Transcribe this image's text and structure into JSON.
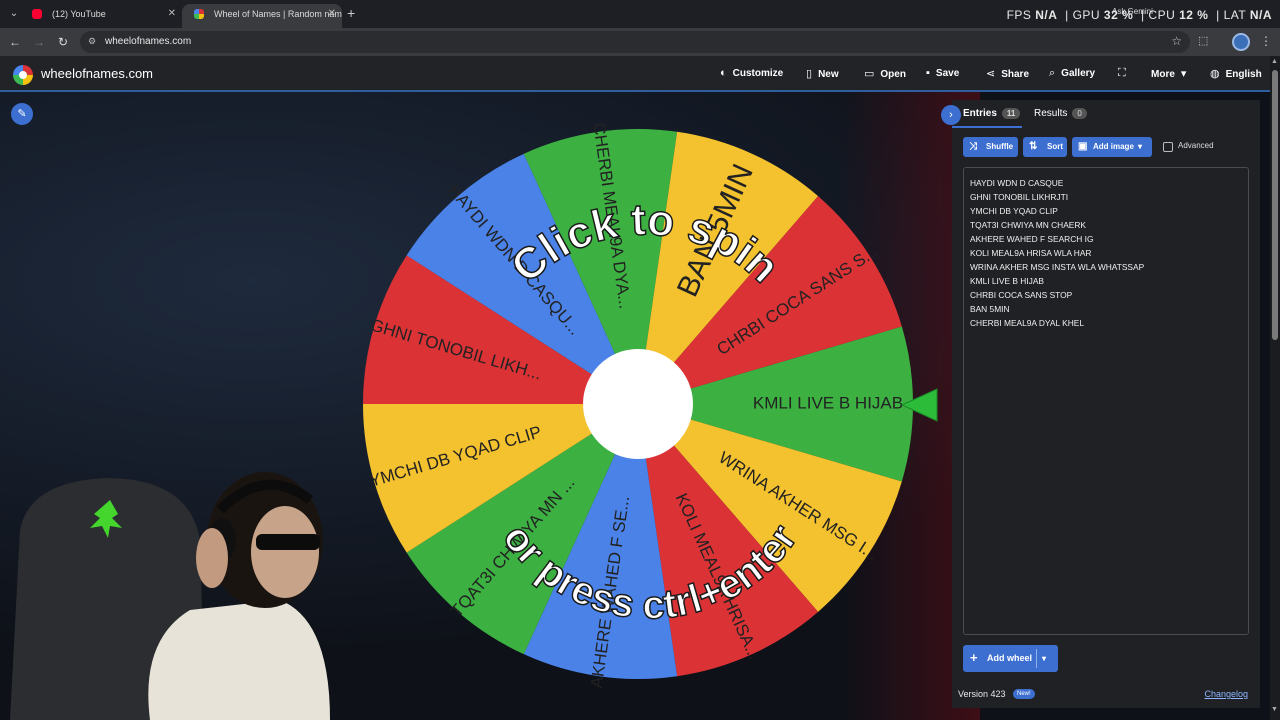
{
  "browser": {
    "tabs": [
      {
        "title": "(12) YouTube",
        "favicon_color": "#ff0033"
      },
      {
        "title": "Wheel of Names | Random nam",
        "favicon_color": "#4885ed"
      }
    ],
    "url": "wheelofnames.com",
    "overlay": {
      "fps_label": "FPS",
      "fps_value": "N/A",
      "gpu_label": "GPU",
      "gpu_value": "32 %",
      "cpu_label": "CPU",
      "cpu_value": "12 %",
      "lat_label": "LAT",
      "lat_value": "N/A",
      "assistant_label": "Ask Gemini"
    }
  },
  "app": {
    "brand": "wheelofnames.com",
    "menu": [
      {
        "label": "Customize",
        "icon": "palette-icon"
      },
      {
        "label": "New",
        "icon": "file-icon"
      },
      {
        "label": "Open",
        "icon": "folder-icon"
      },
      {
        "label": "Save",
        "icon": "save-icon"
      },
      {
        "label": "Share",
        "icon": "share-icon"
      },
      {
        "label": "Gallery",
        "icon": "search-icon"
      },
      {
        "label": "",
        "icon": "fullscreen-icon"
      },
      {
        "label": "More",
        "icon": "chevron-down-icon"
      },
      {
        "label": "English",
        "icon": "globe-icon"
      }
    ]
  },
  "wheel": {
    "prompt_top": "Click to spin",
    "prompt_bottom": "or press ctrl+enter",
    "colors": [
      "#3cb142",
      "#f4c22f",
      "#db3236",
      "#4a82e8"
    ],
    "segments": [
      "KMLI LIVE B HIJAB",
      "WRINA AKHER MSG I...",
      "KOLI MEAL9A HRISA...",
      "AKHERE WAHED F SE...",
      "TQAT3I CHWIYA MN ...",
      "YMCHI DB YQAD CLIP",
      "GHNI TONOBIL LIKH...",
      "HAYDI WDN D CASQU...",
      "CHERBI MEAL9A DYA...",
      "BAN 5MIN",
      "CHRBI COCA SANS S..."
    ]
  },
  "panel": {
    "tabs": [
      {
        "label": "Entries",
        "count": "11"
      },
      {
        "label": "Results",
        "count": "0"
      }
    ],
    "buttons": {
      "shuffle": "Shuffle",
      "sort": "Sort",
      "add_image": "Add image",
      "advanced": "Advanced"
    },
    "entries": [
      "HAYDI WDN D CASQUE",
      "GHNI TONOBIL LIKHRJTI",
      "YMCHI DB YQAD CLIP",
      "TQAT3I CHWIYA MN CHAERK",
      "AKHERE WAHED F SEARCH IG",
      "KOLI MEAL9A HRISA WLA HAR",
      "WRINA AKHER MSG INSTA WLA WHATSSAP",
      "KMLI LIVE B HIJAB",
      "CHRBI COCA SANS STOP",
      "BAN 5MIN",
      "CHERBI MEAL9A DYAL KHEL"
    ],
    "add_wheel": "Add wheel",
    "version": "Version 423",
    "new_badge": "New!",
    "changelog": "Changelog"
  }
}
